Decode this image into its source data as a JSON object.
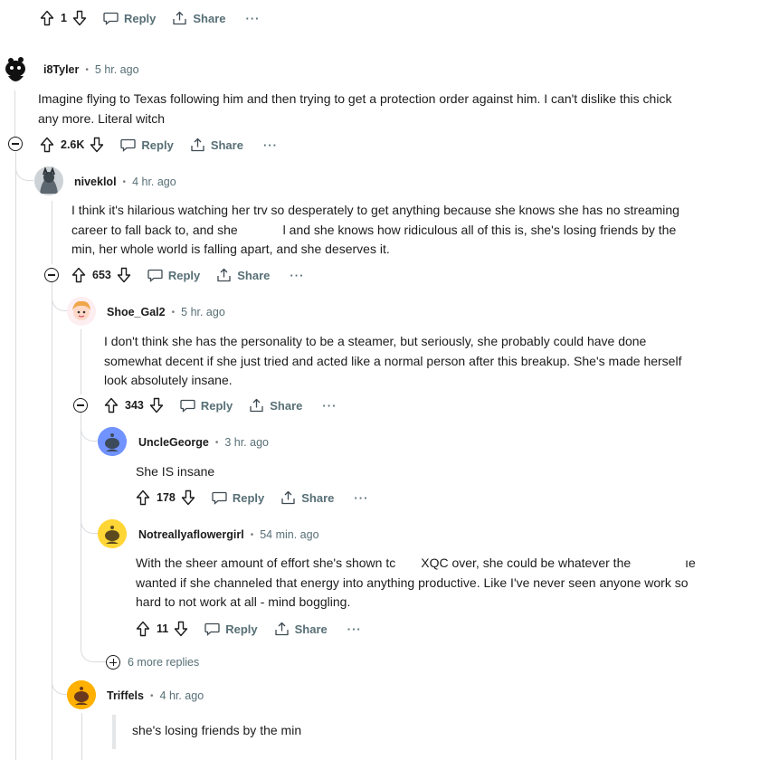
{
  "actions_labels": {
    "reply": "Reply",
    "share": "Share",
    "more": "···"
  },
  "top_comment": {
    "score": "1"
  },
  "comments": [
    {
      "id": "c1",
      "username": "i8Tyler",
      "time": "5 hr. ago",
      "body": [
        "Imagine flying to Texas following him and then trying to get a protection order against him. I can't dislike this chick",
        "any more. Literal witch"
      ],
      "score": "2.6K"
    },
    {
      "id": "c2",
      "username": "niveklol",
      "time": "4 hr. ago",
      "body": [
        "I think it's hilarious watching her trv so desperately to get anything because she knows she has no streaming",
        "career to fall back to, and she",
        "l and she knows how ridiculous all of this is, she's losing friends by the",
        "min, her whole world is falling apart, and she deserves it."
      ],
      "score": "653"
    },
    {
      "id": "c3",
      "username": "Shoe_Gal2",
      "time": "5 hr. ago",
      "body": [
        "I don't think she has the personality to be a steamer, but seriously, she probably could have done",
        "somewhat decent if she just tried and acted like a normal person after this breakup. She's made herself",
        "look absolutely insane."
      ],
      "score": "343"
    },
    {
      "id": "c4",
      "username": "UncleGeorge",
      "time": "3 hr. ago",
      "body": [
        "She IS insane"
      ],
      "score": "178"
    },
    {
      "id": "c5",
      "username": "Notreallyaflowergirl",
      "time": "54 min. ago",
      "body": [
        "With the sheer amount of effort she's shown tc",
        "XQC over, she could be whatever the",
        "ıe",
        "wanted if she channeled that energy into anything productive. Like I've never seen anyone work so",
        "hard to not work at all - mind boggling."
      ],
      "score": "11"
    },
    {
      "id": "c6",
      "username": "Triffels",
      "time": "4 hr. ago",
      "body": [
        "she's losing friends by the min"
      ]
    }
  ],
  "more_replies": "6 more replies",
  "colors": {
    "avatar_blue": "#7193ff",
    "avatar_yellow": "#ffd635",
    "avatar_orange": "#ffb000",
    "thread_line": "#d8dadd"
  }
}
